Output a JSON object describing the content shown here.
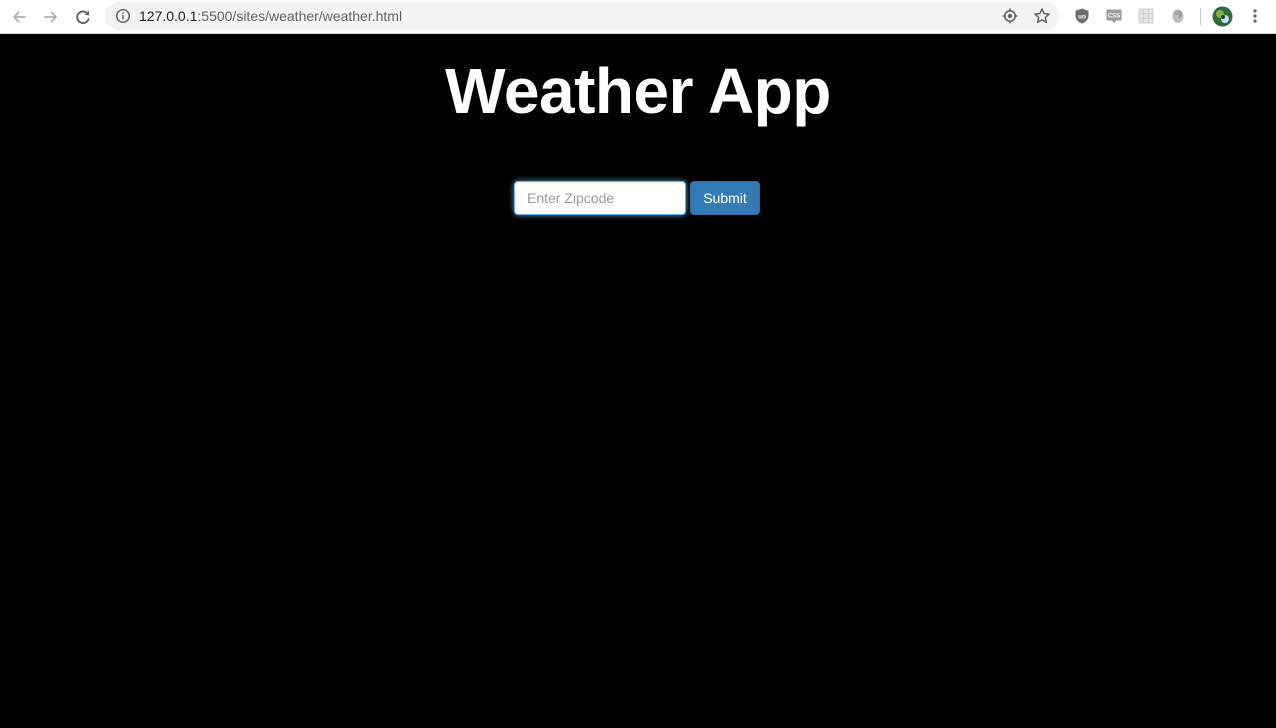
{
  "browser": {
    "url_host": "127.0.0.1",
    "url_rest": ":5500/sites/weather/weather.html"
  },
  "page": {
    "title": "Weather App",
    "zip_placeholder": "Enter Zipcode",
    "zip_value": "",
    "submit_label": "Submit"
  },
  "colors": {
    "page_background": "#000000",
    "title_color": "#ffffff",
    "button_color": "#337ab7",
    "input_focus_glow": "#66afe9"
  }
}
